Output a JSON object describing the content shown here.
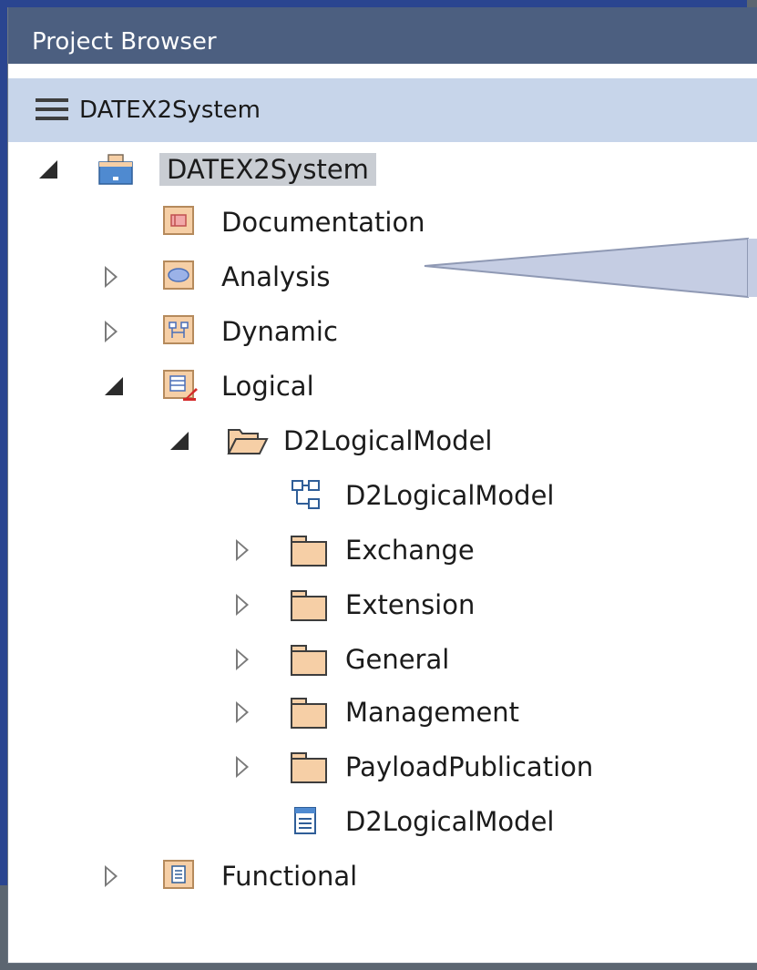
{
  "window": {
    "title": "Project Browser"
  },
  "toolbar": {
    "menu_icon": "hamburger-icon",
    "breadcrumb": "DATEX2System"
  },
  "tree": {
    "root": {
      "label": "DATEX2System",
      "icon": "model-root-icon",
      "expanded": true,
      "selected": true
    },
    "documentation": {
      "label": "Documentation",
      "icon": "documentation-package-icon"
    },
    "analysis": {
      "label": "Analysis",
      "icon": "use-case-package-icon",
      "expanded": false
    },
    "dynamic": {
      "label": "Dynamic",
      "icon": "dynamic-package-icon",
      "expanded": false
    },
    "logical": {
      "label": "Logical",
      "icon": "logical-package-icon",
      "expanded": true
    },
    "d2logicalmodel_folder": {
      "label": "D2LogicalModel",
      "icon": "open-folder-icon",
      "expanded": true
    },
    "d2logicalmodel_diagram": {
      "label": "D2LogicalModel",
      "icon": "class-diagram-icon"
    },
    "exchange": {
      "label": "Exchange",
      "icon": "folder-icon",
      "expanded": false
    },
    "extension": {
      "label": "Extension",
      "icon": "folder-icon",
      "expanded": false
    },
    "general": {
      "label": "General",
      "icon": "folder-icon",
      "expanded": false
    },
    "management": {
      "label": "Management",
      "icon": "folder-icon",
      "expanded": false
    },
    "payloadpublication": {
      "label": "PayloadPublication",
      "icon": "folder-icon",
      "expanded": false
    },
    "d2logicalmodel_doc": {
      "label": "D2LogicalModel",
      "icon": "document-artifact-icon"
    },
    "functional": {
      "label": "Functional",
      "icon": "functional-package-icon",
      "expanded": false
    }
  },
  "colors": {
    "titlebar": "#4c5f80",
    "toolbar": "#c7d5ea",
    "selection": "#c9cdd3",
    "package_fill": "#f6cfa6",
    "callout": "#c5cde3"
  }
}
